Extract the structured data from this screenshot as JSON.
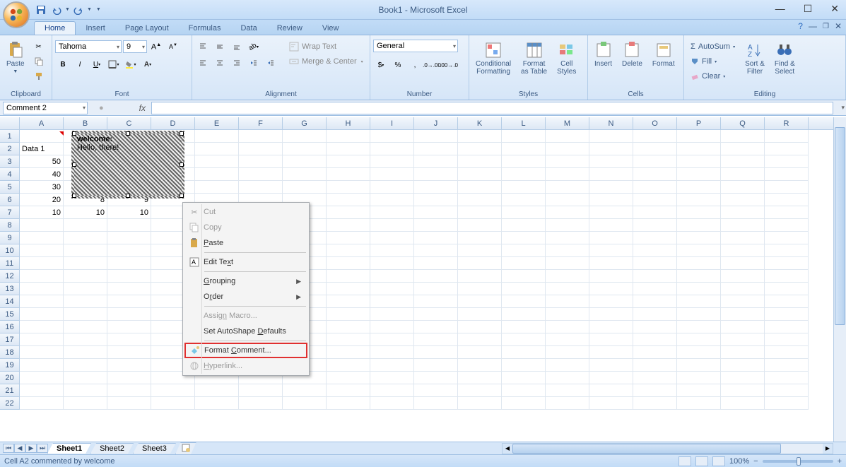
{
  "title": "Book1 - Microsoft Excel",
  "tabs": {
    "home": "Home",
    "insert": "Insert",
    "page_layout": "Page Layout",
    "formulas": "Formulas",
    "data": "Data",
    "review": "Review",
    "view": "View"
  },
  "ribbon": {
    "clipboard": {
      "label": "Clipboard",
      "paste": "Paste"
    },
    "font": {
      "label": "Font",
      "name": "Tahoma",
      "size": "9"
    },
    "alignment": {
      "label": "Alignment",
      "wrap": "Wrap Text",
      "merge": "Merge & Center"
    },
    "number": {
      "label": "Number",
      "format": "General"
    },
    "styles": {
      "label": "Styles",
      "cond": "Conditional\nFormatting",
      "table": "Format\nas Table",
      "cell": "Cell\nStyles"
    },
    "cells": {
      "label": "Cells",
      "insert": "Insert",
      "delete": "Delete",
      "format": "Format"
    },
    "editing": {
      "label": "Editing",
      "autosum": "AutoSum",
      "fill": "Fill",
      "clear": "Clear",
      "sort": "Sort &\nFilter",
      "find": "Find &\nSelect"
    }
  },
  "name_box": "Comment 2",
  "columns": [
    "A",
    "B",
    "C",
    "D",
    "E",
    "F",
    "G",
    "H",
    "I",
    "J",
    "K",
    "L",
    "M",
    "N",
    "O",
    "P",
    "Q",
    "R"
  ],
  "row_count": 22,
  "cells": {
    "A2": "Data 1",
    "A3": "50",
    "A4": "40",
    "A5": "30",
    "A6": "20",
    "A7": "10",
    "B6": "8",
    "B7": "10",
    "C6": "9",
    "C7": "10"
  },
  "comment": {
    "author": "welcome:",
    "text": "Hello, there!"
  },
  "context_menu": {
    "cut": "Cut",
    "copy": "Copy",
    "paste": "Paste",
    "edit_text": "Edit Text",
    "grouping": "Grouping",
    "order": "Order",
    "assign_macro": "Assign Macro...",
    "set_defaults": "Set AutoShape Defaults",
    "format_comment": "Format Comment...",
    "hyperlink": "Hyperlink..."
  },
  "sheets": {
    "s1": "Sheet1",
    "s2": "Sheet2",
    "s3": "Sheet3"
  },
  "status": "Cell A2 commented by welcome",
  "zoom": "100%"
}
